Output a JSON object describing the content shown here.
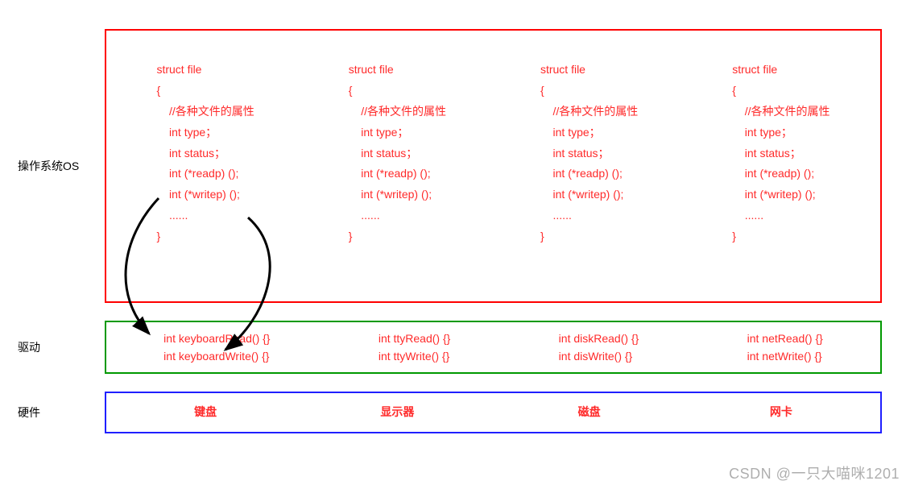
{
  "labels": {
    "os": "操作系统OS",
    "driver": "驱动",
    "hardware": "硬件"
  },
  "struct_file": {
    "header": "struct file",
    "open": "{",
    "comment": "    //各种文件的属性",
    "lines": [
      "    int type；",
      "    int status；",
      "    int (*readp) ();",
      "    int (*writep) ();",
      "    ......"
    ],
    "close": "}"
  },
  "drivers": [
    {
      "read": "int keyboardRead() {}",
      "write": "int keyboardWrite() {}"
    },
    {
      "read": "int ttyRead() {}",
      "write": "int ttyWrite() {}"
    },
    {
      "read": "int diskRead() {}",
      "write": "int disWrite() {}"
    },
    {
      "read": "int netRead() {}",
      "write": "int netWrite() {}"
    }
  ],
  "hardware": [
    "键盘",
    "显示器",
    "磁盘",
    "网卡"
  ],
  "watermark": "CSDN @一只大喵咪1201"
}
